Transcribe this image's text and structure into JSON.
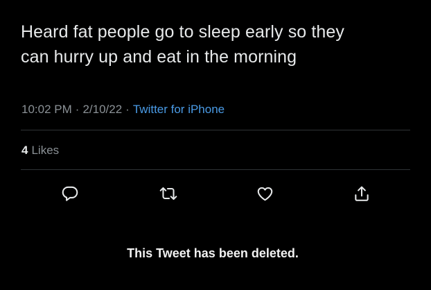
{
  "tweet": {
    "text_line1": "Heard fat people go to sleep early so they",
    "text_line2": "can hurry up and eat in the morning",
    "time": "10:02 PM",
    "separator": "·",
    "date": "2/10/22",
    "source": "Twitter for iPhone",
    "likes_count": "4",
    "likes_label": "Likes"
  },
  "actions": {
    "icons": [
      "reply-icon",
      "retweet-icon",
      "like-icon",
      "share-icon"
    ]
  },
  "notice": {
    "text": "This Tweet has been deleted."
  },
  "colors": {
    "background": "#000000",
    "text_primary": "#e7e9ea",
    "text_secondary": "#8b9196",
    "link": "#4a9be6",
    "divider": "#2f3336"
  }
}
